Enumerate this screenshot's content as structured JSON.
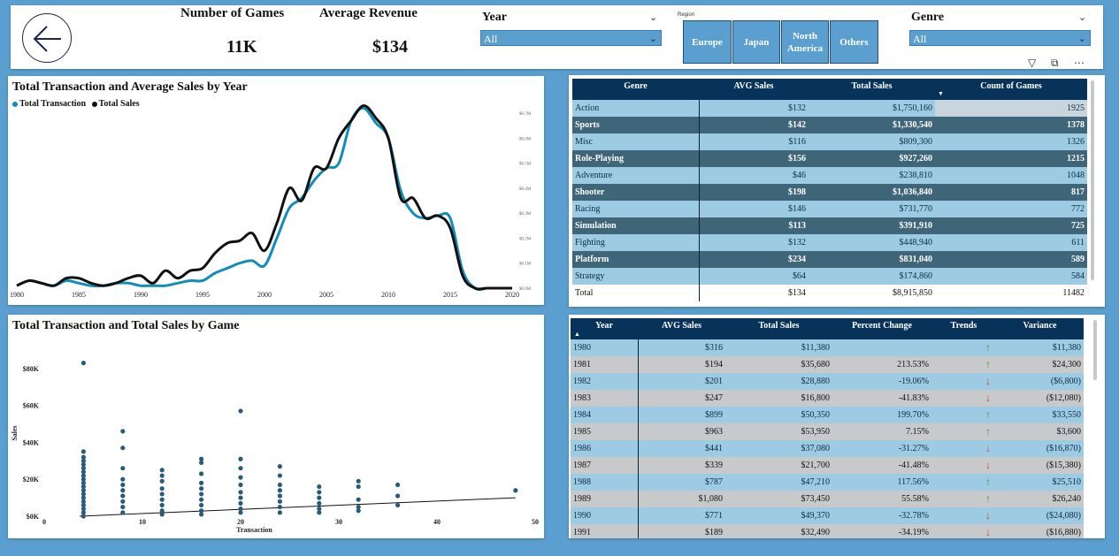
{
  "header": {
    "kpis": [
      {
        "label": "Number of Games",
        "value": "11K"
      },
      {
        "label": "Average Revenue",
        "value": "$134"
      }
    ],
    "year_slicer": {
      "title": "Year",
      "value": "All"
    },
    "region_slicer": {
      "title": "Region",
      "options": [
        "Europe",
        "Japan",
        "North America",
        "Others"
      ]
    },
    "genre_slicer": {
      "title": "Genre",
      "value": "All"
    }
  },
  "line_chart": {
    "title": "Total Transaction and Average Sales by Year",
    "legend": [
      {
        "name": "Total Transaction",
        "color": "#118dba"
      },
      {
        "name": "Total Sales",
        "color": "#111111"
      }
    ],
    "x_ticks": [
      "1980",
      "1985",
      "1990",
      "1995",
      "2000",
      "2005",
      "2010",
      "2015",
      "2020"
    ],
    "y_ticks": [
      "$0.0M",
      "$0.1M",
      "$0.2M",
      "$0.3M",
      "$0.4M",
      "$0.5M",
      "$0.6M",
      "$0.7M"
    ]
  },
  "scatter_chart": {
    "title": "Total Transaction and Total Sales by Game",
    "xlabel": "Transaction",
    "ylabel": "Sales",
    "x_ticks": [
      "0",
      "10",
      "20",
      "30",
      "40",
      "50"
    ],
    "y_ticks": [
      "$0K",
      "$20K",
      "$40K",
      "$60K",
      "$80K"
    ]
  },
  "chart_data": [
    {
      "type": "line",
      "title": "Total Transaction and Average Sales by Year",
      "x": [
        1980,
        1981,
        1982,
        1983,
        1984,
        1985,
        1986,
        1987,
        1988,
        1989,
        1990,
        1991,
        1992,
        1993,
        1994,
        1995,
        1996,
        1997,
        1998,
        1999,
        2000,
        2001,
        2002,
        2003,
        2004,
        2005,
        2006,
        2007,
        2008,
        2009,
        2010,
        2011,
        2012,
        2013,
        2014,
        2015,
        2016,
        2017,
        2018,
        2019,
        2020
      ],
      "xlim": [
        1980,
        2020
      ],
      "ylim": [
        0,
        0.7
      ],
      "series": [
        {
          "name": "Total Transaction",
          "color": "#118dba",
          "y": [
            0.01,
            0.03,
            0.02,
            0.01,
            0.03,
            0.02,
            0.01,
            0.01,
            0.02,
            0.02,
            0.01,
            0.01,
            0.01,
            0.02,
            0.03,
            0.03,
            0.06,
            0.08,
            0.1,
            0.11,
            0.09,
            0.2,
            0.32,
            0.36,
            0.43,
            0.48,
            0.5,
            0.67,
            0.72,
            0.66,
            0.6,
            0.39,
            0.3,
            0.28,
            0.29,
            0.28,
            0.07,
            0.0,
            0.0,
            0.0,
            0.0
          ]
        },
        {
          "name": "Total Sales",
          "color": "#111111",
          "y": [
            0.01,
            0.03,
            0.02,
            0.01,
            0.04,
            0.04,
            0.02,
            0.01,
            0.02,
            0.04,
            0.05,
            0.02,
            0.07,
            0.04,
            0.07,
            0.08,
            0.14,
            0.18,
            0.19,
            0.22,
            0.15,
            0.26,
            0.4,
            0.35,
            0.48,
            0.48,
            0.6,
            0.67,
            0.73,
            0.68,
            0.6,
            0.36,
            0.36,
            0.28,
            0.29,
            0.24,
            0.05,
            0.0,
            0.0,
            0.0,
            0.0
          ]
        }
      ]
    },
    {
      "type": "scatter",
      "title": "Total Transaction and Total Sales by Game",
      "xlabel": "Transaction",
      "ylabel": "Sales",
      "xlim": [
        0,
        50
      ],
      "ylim": [
        0,
        90000
      ],
      "points": [
        [
          4,
          83000
        ],
        [
          4,
          35000
        ],
        [
          4,
          32000
        ],
        [
          4,
          30000
        ],
        [
          4,
          28000
        ],
        [
          4,
          26000
        ],
        [
          4,
          24000
        ],
        [
          4,
          22000
        ],
        [
          4,
          20000
        ],
        [
          4,
          18000
        ],
        [
          4,
          16000
        ],
        [
          4,
          14000
        ],
        [
          4,
          12000
        ],
        [
          4,
          10000
        ],
        [
          4,
          8000
        ],
        [
          4,
          6000
        ],
        [
          4,
          4000
        ],
        [
          4,
          2000
        ],
        [
          4,
          0
        ],
        [
          8,
          46000
        ],
        [
          8,
          37000
        ],
        [
          8,
          26000
        ],
        [
          8,
          20000
        ],
        [
          8,
          17000
        ],
        [
          8,
          14000
        ],
        [
          8,
          11000
        ],
        [
          8,
          8000
        ],
        [
          8,
          5000
        ],
        [
          8,
          2000
        ],
        [
          12,
          25000
        ],
        [
          12,
          22000
        ],
        [
          12,
          19000
        ],
        [
          12,
          15000
        ],
        [
          12,
          12000
        ],
        [
          12,
          9000
        ],
        [
          12,
          6000
        ],
        [
          12,
          3000
        ],
        [
          12,
          1000
        ],
        [
          16,
          31000
        ],
        [
          16,
          29000
        ],
        [
          16,
          23000
        ],
        [
          16,
          18000
        ],
        [
          16,
          15000
        ],
        [
          16,
          12000
        ],
        [
          16,
          9000
        ],
        [
          16,
          6000
        ],
        [
          16,
          3000
        ],
        [
          16,
          1000
        ],
        [
          20,
          57000
        ],
        [
          20,
          31000
        ],
        [
          20,
          26000
        ],
        [
          20,
          21000
        ],
        [
          20,
          17000
        ],
        [
          20,
          13000
        ],
        [
          20,
          10000
        ],
        [
          20,
          7000
        ],
        [
          20,
          4000
        ],
        [
          20,
          2000
        ],
        [
          24,
          27000
        ],
        [
          24,
          22000
        ],
        [
          24,
          17000
        ],
        [
          24,
          14000
        ],
        [
          24,
          11000
        ],
        [
          24,
          8000
        ],
        [
          24,
          5000
        ],
        [
          24,
          2000
        ],
        [
          28,
          16000
        ],
        [
          28,
          13000
        ],
        [
          28,
          10000
        ],
        [
          28,
          7000
        ],
        [
          28,
          4000
        ],
        [
          28,
          2000
        ],
        [
          32,
          19000
        ],
        [
          32,
          16000
        ],
        [
          32,
          9000
        ],
        [
          32,
          5000
        ],
        [
          32,
          3000
        ],
        [
          36,
          17000
        ],
        [
          36,
          11000
        ],
        [
          36,
          6000
        ],
        [
          48,
          14000
        ]
      ],
      "trendline": [
        [
          0,
          0
        ],
        [
          48,
          10000
        ]
      ]
    }
  ],
  "genre_table": {
    "columns": [
      "Genre",
      "AVG Sales",
      "Total Sales",
      "Count of Games"
    ],
    "rows": [
      [
        "Action",
        "$132",
        "$1,750,160",
        "1925"
      ],
      [
        "Sports",
        "$142",
        "$1,330,540",
        "1378"
      ],
      [
        "Misc",
        "$116",
        "$809,300",
        "1326"
      ],
      [
        "Role-Playing",
        "$156",
        "$927,260",
        "1215"
      ],
      [
        "Adventure",
        "$46",
        "$238,810",
        "1048"
      ],
      [
        "Shooter",
        "$198",
        "$1,036,840",
        "817"
      ],
      [
        "Racing",
        "$146",
        "$731,770",
        "772"
      ],
      [
        "Simulation",
        "$113",
        "$391,910",
        "725"
      ],
      [
        "Fighting",
        "$132",
        "$448,940",
        "611"
      ],
      [
        "Platform",
        "$234",
        "$831,040",
        "589"
      ],
      [
        "Strategy",
        "$64",
        "$174,860",
        "584"
      ]
    ],
    "total": [
      "Total",
      "$134",
      "$8,915,850",
      "11482"
    ]
  },
  "year_table": {
    "columns": [
      "Year",
      "AVG Sales",
      "Total Sales",
      "Percent Change",
      "Trends",
      "Variance"
    ],
    "rows": [
      [
        "1980",
        "$316",
        "$11,380",
        "",
        "up",
        "$11,380"
      ],
      [
        "1981",
        "$194",
        "$35,680",
        "213.53%",
        "up",
        "$24,300"
      ],
      [
        "1982",
        "$201",
        "$28,880",
        "-19.06%",
        "down",
        "($6,800)"
      ],
      [
        "1983",
        "$247",
        "$16,800",
        "-41.83%",
        "down",
        "($12,080)"
      ],
      [
        "1984",
        "$899",
        "$50,350",
        "199.70%",
        "up",
        "$33,550"
      ],
      [
        "1985",
        "$963",
        "$53,950",
        "7.15%",
        "up",
        "$3,600"
      ],
      [
        "1986",
        "$441",
        "$37,080",
        "-31.27%",
        "down",
        "($16,870)"
      ],
      [
        "1987",
        "$339",
        "$21,700",
        "-41.48%",
        "down",
        "($15,380)"
      ],
      [
        "1988",
        "$787",
        "$47,210",
        "117.56%",
        "up",
        "$25,510"
      ],
      [
        "1989",
        "$1,080",
        "$73,450",
        "55.58%",
        "up",
        "$26,240"
      ],
      [
        "1990",
        "$771",
        "$49,370",
        "-32.78%",
        "down",
        "($24,080)"
      ],
      [
        "1991",
        "$189",
        "$32,490",
        "-34.19%",
        "down",
        "($16,880)"
      ]
    ]
  },
  "visual_header_icons": [
    "filter-icon",
    "focus-mode-icon",
    "more-options-icon"
  ]
}
